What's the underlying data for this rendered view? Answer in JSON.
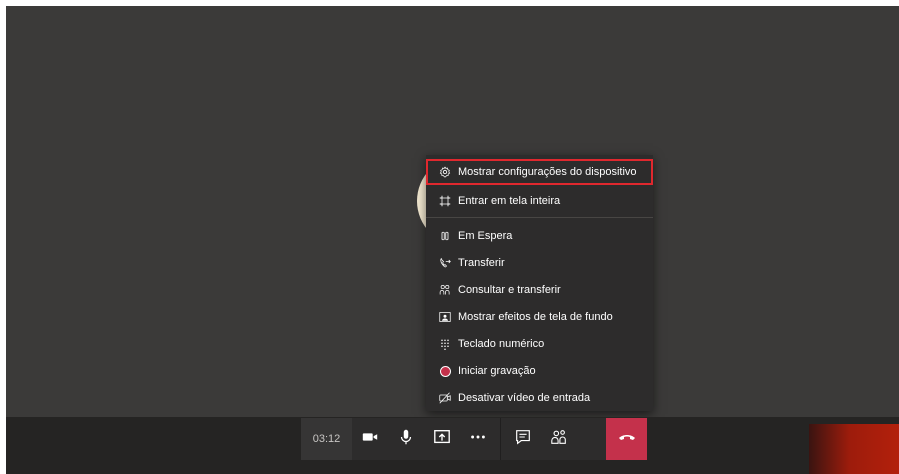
{
  "menu": {
    "items": [
      {
        "label": "Mostrar configurações do dispositivo",
        "icon": "gear-icon",
        "highlighted": true
      },
      {
        "label": "Entrar em tela inteira",
        "icon": "fullscreen-icon"
      },
      {
        "label": "Em Espera",
        "icon": "pause-icon"
      },
      {
        "label": "Transferir",
        "icon": "transfer-call-icon"
      },
      {
        "label": "Consultar e transferir",
        "icon": "consult-transfer-icon"
      },
      {
        "label": "Mostrar efeitos de tela de fundo",
        "icon": "background-effects-icon"
      },
      {
        "label": "Teclado numérico",
        "icon": "dialpad-icon"
      },
      {
        "label": "Iniciar gravação",
        "icon": "record-icon"
      },
      {
        "label": "Desativar vídeo de entrada",
        "icon": "video-off-icon"
      }
    ]
  },
  "toolbar": {
    "timer": "03:12",
    "buttons": [
      "camera-icon",
      "microphone-icon",
      "share-screen-icon",
      "more-options-icon",
      "chat-icon",
      "participants-icon",
      "hang-up-icon"
    ]
  },
  "colors": {
    "highlight_border": "#e0282e",
    "hangup": "#c4314b",
    "menu_bg": "#2d2c2c",
    "stage_bg": "#3b3a39"
  }
}
